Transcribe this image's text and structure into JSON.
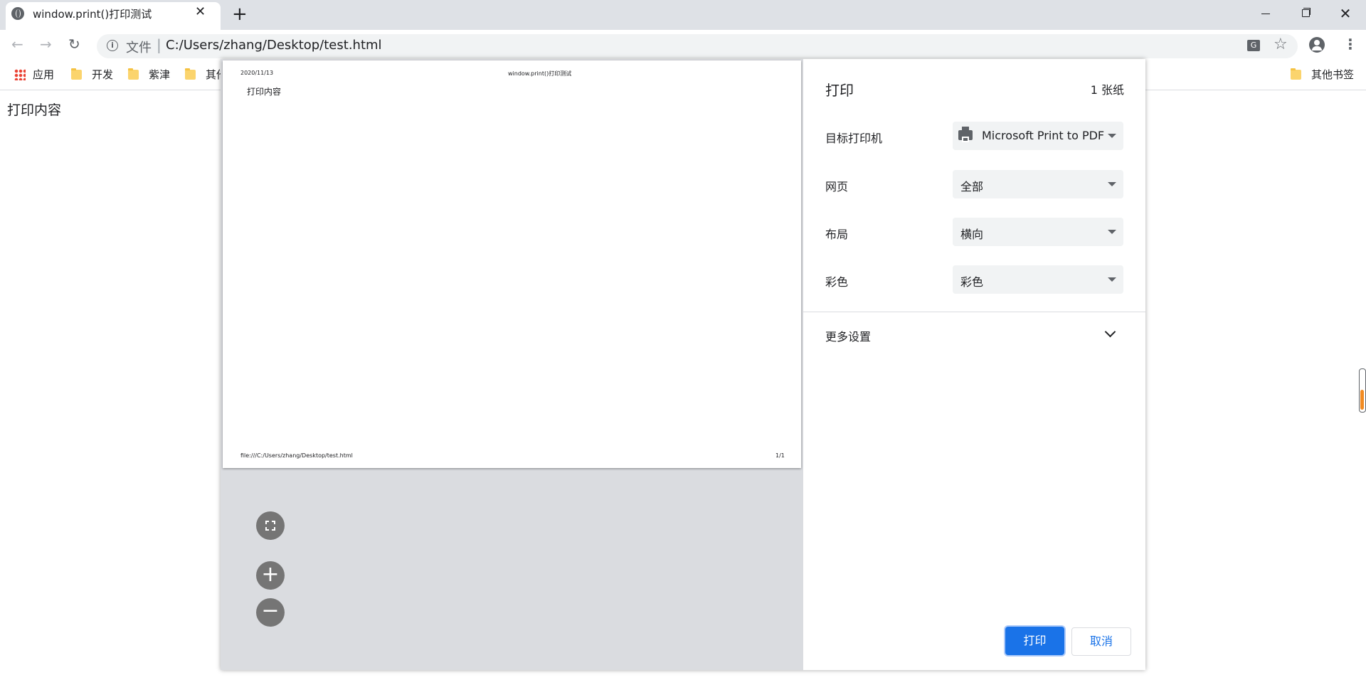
{
  "browser": {
    "tab_title": "window.print()打印测试",
    "new_tab": "+",
    "tab_close": "✕",
    "window_close": "✕"
  },
  "toolbar": {
    "omnibox_scheme": "文件",
    "omnibox_sep": "|",
    "omnibox_url": "C:/Users/zhang/Desktop/test.html"
  },
  "bookmarks": {
    "items": [
      "应用",
      "开发",
      "紫津",
      "其他"
    ],
    "other": "其他书签"
  },
  "page": {
    "content": "打印内容"
  },
  "print_preview": {
    "header_date": "2020/11/13",
    "header_title": "window.print()打印测试",
    "body_text": "打印内容",
    "footer_url": "file:///C:/Users/zhang/Desktop/test.html",
    "footer_page": "1/1"
  },
  "print_settings": {
    "title": "打印",
    "sheet_count": "1 张纸",
    "printer_label": "目标打印机",
    "printer_value": "Microsoft Print to PDF",
    "pages_label": "网页",
    "pages_value": "全部",
    "layout_label": "布局",
    "layout_value": "横向",
    "color_label": "彩色",
    "color_value": "彩色",
    "more_settings": "更多设置",
    "print_button": "打印",
    "cancel_button": "取消"
  },
  "colors": {
    "accent": "#1a73e8",
    "preview_bg": "#dadce0",
    "zoom_button": "#757575"
  }
}
